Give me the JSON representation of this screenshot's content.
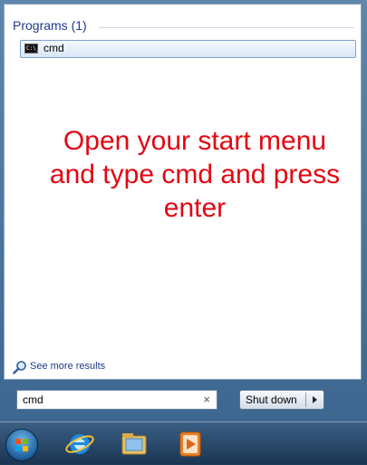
{
  "start_menu": {
    "programs_header": "Programs (1)",
    "results": [
      {
        "label": "cmd",
        "icon": "command-prompt-icon"
      }
    ],
    "see_more_results": "See more results",
    "search": {
      "value": "cmd",
      "clear_icon": "×"
    },
    "shutdown_label": "Shut down"
  },
  "annotation": {
    "text": "Open your start menu and type cmd and press enter",
    "color": "#e30613"
  },
  "taskbar": {
    "icons": [
      "windows-orb-icon",
      "internet-explorer-icon",
      "windows-explorer-icon",
      "windows-media-player-icon"
    ]
  }
}
